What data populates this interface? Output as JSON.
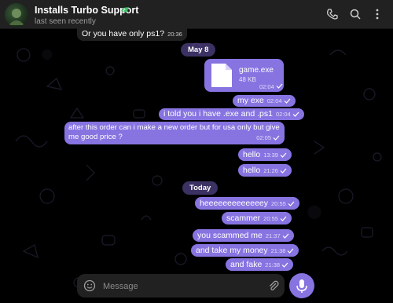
{
  "header": {
    "title": "Installs Turbo Support",
    "subtitle": "last seen recently"
  },
  "messages": {
    "m0": {
      "text": "Or you have only ps1?",
      "time": "20:36"
    },
    "date1": "May 8",
    "file": {
      "name": "game.exe",
      "size": "48 KB",
      "time": "02:04"
    },
    "m1": {
      "text": "my exe",
      "time": "02:04"
    },
    "m2": {
      "text": "i told you i have .exe and .ps1",
      "time": "02:04"
    },
    "m3": {
      "line1": "after this order can i make a new order but for usa only but give",
      "line2": "me good price ?",
      "time": "02:05"
    },
    "m4": {
      "text": "hello",
      "time": "13:39"
    },
    "m5": {
      "text": "hello",
      "time": "21:26"
    },
    "date2": "Today",
    "m6": {
      "text": "heeeeeeeeeeeeey",
      "time": "20:55"
    },
    "m7": {
      "text": "scammer",
      "time": "20:55"
    },
    "m8": {
      "text": "you  scammed me",
      "time": "21:37"
    },
    "m9": {
      "text": "and take my money",
      "time": "21:38"
    },
    "m10": {
      "text": "and fake",
      "time": "21:38"
    }
  },
  "composer": {
    "placeholder": "Message"
  },
  "colors": {
    "accent": "#8774e1",
    "header_bg": "#212121",
    "chat_bg": "#000000"
  },
  "icons": [
    "verified-icon",
    "phone-icon",
    "search-icon",
    "more-icon",
    "file-icon",
    "read-check-icon",
    "emoji-icon",
    "attach-icon",
    "microphone-icon"
  ]
}
